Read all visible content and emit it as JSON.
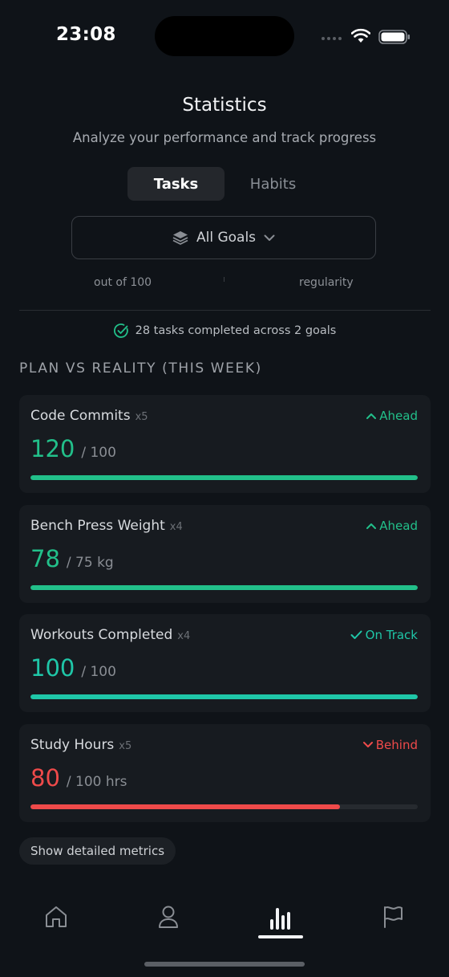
{
  "status_bar": {
    "time": "23:08"
  },
  "header": {
    "title": "Statistics",
    "subtitle": "Analyze your performance and track progress"
  },
  "segments": {
    "tasks": "Tasks",
    "habits": "Habits",
    "selected": "Tasks"
  },
  "filter": {
    "icon": "layers-icon",
    "label": "All Goals"
  },
  "sublabels": {
    "left": "out of 100",
    "right": "regularity"
  },
  "summary": {
    "icon": "check-circle-icon",
    "text": "28 tasks completed across 2 goals"
  },
  "section": {
    "title": "PLAN VS REALITY (THIS WEEK)"
  },
  "metrics": [
    {
      "name": "Code Commits",
      "multiplier": "x5",
      "status": "Ahead",
      "status_icon": "chevron-up-icon",
      "value": "120",
      "target": "/ 100",
      "progress": 1.0,
      "color": "#22c08a"
    },
    {
      "name": "Bench Press Weight",
      "multiplier": "x4",
      "status": "Ahead",
      "status_icon": "chevron-up-icon",
      "value": "78",
      "target": "/ 75 kg",
      "progress": 1.0,
      "color": "#22c08a"
    },
    {
      "name": "Workouts Completed",
      "multiplier": "x4",
      "status": "On Track",
      "status_icon": "check-icon",
      "value": "100",
      "target": "/ 100",
      "progress": 1.0,
      "color": "#1fc7a8"
    },
    {
      "name": "Study Hours",
      "multiplier": "x5",
      "status": "Behind",
      "status_icon": "chevron-down-icon",
      "value": "80",
      "target": "/ 100 hrs",
      "progress": 0.8,
      "color": "#ef4a4a"
    }
  ],
  "details_button": {
    "label": "Show detailed metrics"
  },
  "tabbar": {
    "items": [
      {
        "icon": "home-icon"
      },
      {
        "icon": "profile-icon"
      },
      {
        "icon": "stats-icon",
        "active": true
      },
      {
        "icon": "flag-icon"
      }
    ]
  }
}
